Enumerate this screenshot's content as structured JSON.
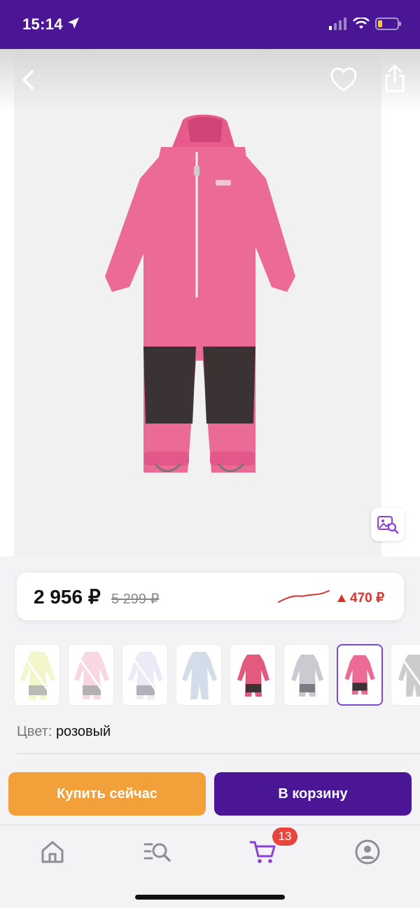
{
  "status_bar": {
    "time": "15:14"
  },
  "product": {
    "price_current": "2 956 ₽",
    "price_old": "5 299 ₽",
    "price_delta": "470 ₽"
  },
  "colors": {
    "label_key": "Цвет:",
    "label_value": "розовый",
    "swatches": [
      {
        "name": "lime"
      },
      {
        "name": "light-pink"
      },
      {
        "name": "lilac"
      },
      {
        "name": "light-blue"
      },
      {
        "name": "pink-pattern"
      },
      {
        "name": "grey"
      },
      {
        "name": "pink",
        "selected": true
      },
      {
        "name": "dark-grey"
      }
    ]
  },
  "actions": {
    "buy_now": "Купить сейчас",
    "add_to_cart": "В корзину"
  },
  "tabbar": {
    "cart_badge": "13",
    "items": [
      "home-icon",
      "catalog-search-icon",
      "cart-icon",
      "profile-icon"
    ]
  },
  "theme": {
    "brand": "#4b1696",
    "accent_orange": "#f2a03a",
    "price_down_red": "#d7322d",
    "cart_active": "#8a3fd6"
  }
}
